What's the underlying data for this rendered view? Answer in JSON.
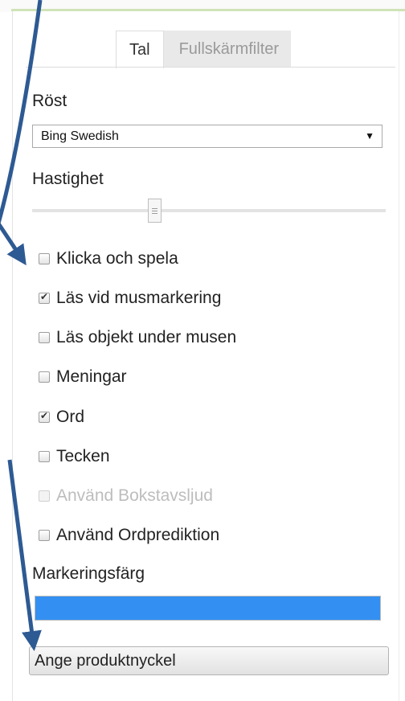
{
  "tabs": [
    {
      "label": "Tal",
      "active": true
    },
    {
      "label": "Fullskärmfilter",
      "active": false
    }
  ],
  "voice": {
    "label": "Röst",
    "selected": "Bing Swedish"
  },
  "speed": {
    "label": "Hastighet",
    "value_fraction": 0.34
  },
  "options": [
    {
      "label": "Klicka och spela",
      "checked": false,
      "disabled": false
    },
    {
      "label": "Läs vid musmarkering",
      "checked": true,
      "disabled": false
    },
    {
      "label": "Läs objekt under musen",
      "checked": false,
      "disabled": false
    },
    {
      "label": "Meningar",
      "checked": false,
      "disabled": false
    },
    {
      "label": "Ord",
      "checked": true,
      "disabled": false
    },
    {
      "label": "Tecken",
      "checked": false,
      "disabled": false
    },
    {
      "label": "Använd Bokstavsljud",
      "checked": false,
      "disabled": true
    },
    {
      "label": "Använd Ordprediktion",
      "checked": false,
      "disabled": false
    }
  ],
  "highlight": {
    "label": "Markeringsfärg",
    "color": "#3390f2"
  },
  "product_key_button": "Ange produktnyckel",
  "annotation_color": "#2e5a93"
}
